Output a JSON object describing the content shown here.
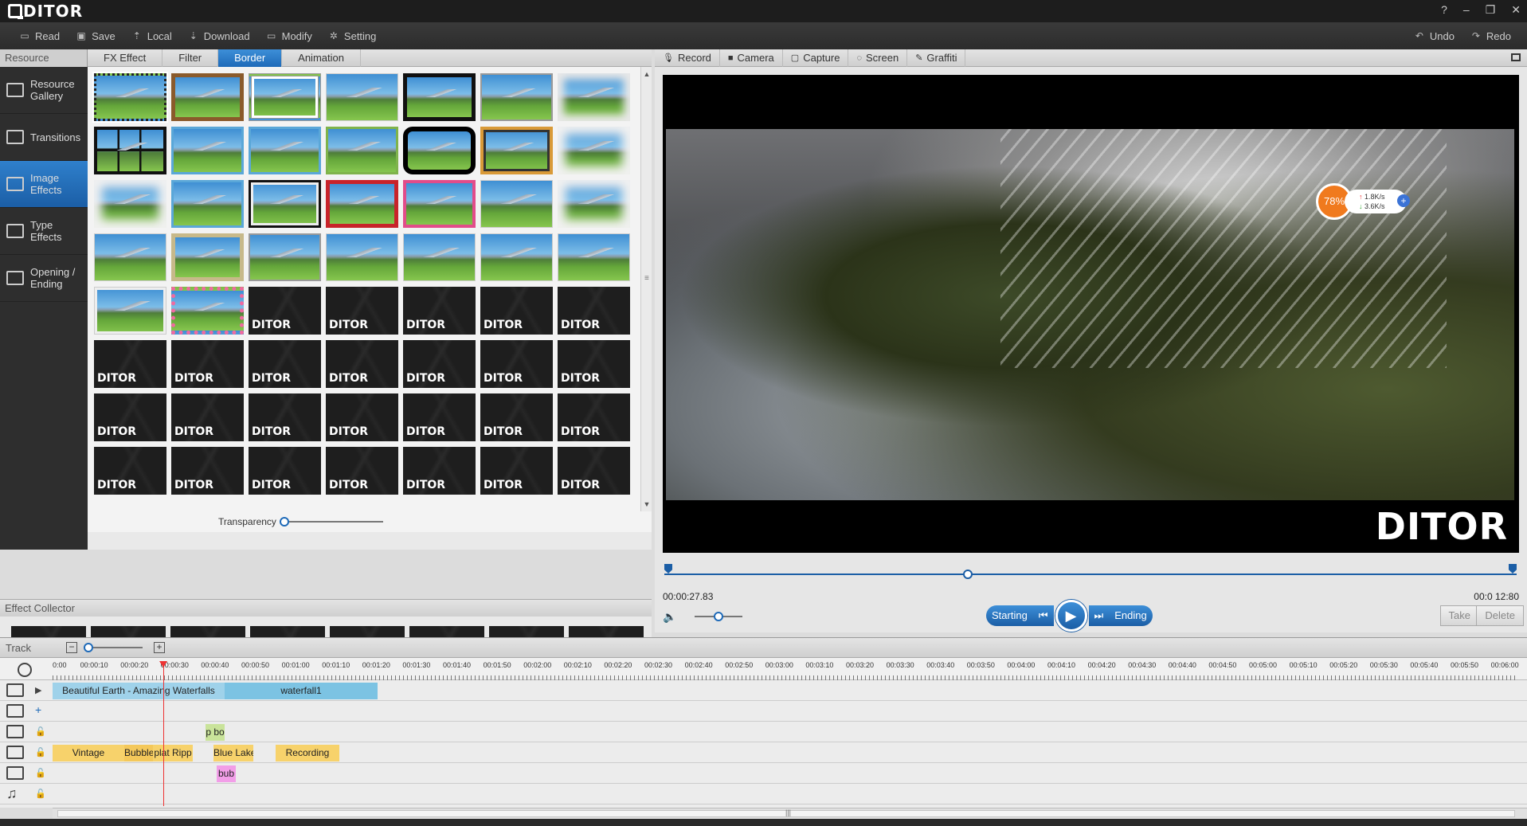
{
  "app": {
    "logo": "DITOR",
    "window_controls": [
      "?",
      "–",
      "❐",
      "✕"
    ]
  },
  "toolbar": {
    "left": [
      {
        "label": "Read",
        "icon": "read-icon"
      },
      {
        "label": "Save",
        "icon": "save-icon"
      },
      {
        "label": "Local",
        "icon": "local-icon"
      },
      {
        "label": "Download",
        "icon": "download-icon"
      },
      {
        "label": "Modify",
        "icon": "modify-icon"
      },
      {
        "label": "Setting",
        "icon": "gear-icon"
      }
    ],
    "undo": "Undo",
    "redo": "Redo"
  },
  "resource": {
    "header": "Resource",
    "tabs": [
      "FX Effect",
      "Filter",
      "Border",
      "Animation"
    ],
    "active_tab": "Border",
    "sidebar": [
      {
        "label": "Resource Gallery"
      },
      {
        "label": "Transitions"
      },
      {
        "label": "Image Effects",
        "active": true
      },
      {
        "label": "Type Effects"
      },
      {
        "label": "Opening / Ending"
      }
    ],
    "placeholder_mark": "DITOR",
    "transparency_label": "Transparency",
    "transparency_value": 0
  },
  "collector": {
    "header": "Effect Collector",
    "count": 8,
    "mark": "DITOR"
  },
  "preview": {
    "tabs": [
      "Record",
      "Camera",
      "Capture",
      "Screen",
      "Graffiti"
    ],
    "watermark": "DITOR",
    "net_widget": {
      "percent": "78%",
      "up": "1.8K/s",
      "down": "3.6K/s"
    },
    "time_current": "00:00:27.83",
    "time_total": "00:0 12:80",
    "seek_fraction": 0.35,
    "volume_fraction": 0.5,
    "starting": "Starting",
    "ending": "Ending",
    "take": "Take",
    "delete": "Delete"
  },
  "timeline": {
    "header": "Track",
    "zoom_fraction": 0.05,
    "ruler_labels": [
      "0:00",
      "00:00:10",
      "00:00:20",
      "00:00:30",
      "00:00:40",
      "00:00:50",
      "00:01:00",
      "00:01:10",
      "00:01:20",
      "00:01:30",
      "00:01:40",
      "00:01:50",
      "00:02:00",
      "00:02:10",
      "00:02:20",
      "00:02:30",
      "00:02:40",
      "00:02:50",
      "00:03:00",
      "00:03:10",
      "00:03:20",
      "00:03:30",
      "00:03:40",
      "00:03:50",
      "00:04:00",
      "00:04:10",
      "00:04:20",
      "00:04:30",
      "00:04:40",
      "00:04:50",
      "00:05:00",
      "00:05:10",
      "00:05:20",
      "00:05:30",
      "00:05:40",
      "00:05:50",
      "00:06:00"
    ],
    "video_clips": [
      "Beautiful Earth - Amazing Waterfalls",
      "waterfall1"
    ],
    "transition_clips": [
      "p bo"
    ],
    "effect_clips": [
      "Vintage",
      "Bubble",
      "plat Ripp",
      "Blue Lake",
      "Recording"
    ],
    "type_clips": [
      "bub"
    ]
  }
}
